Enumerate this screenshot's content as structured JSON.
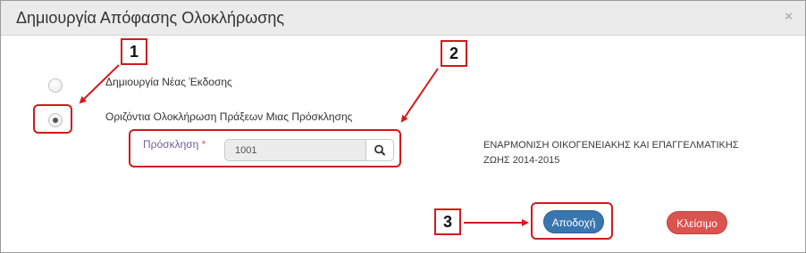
{
  "dialog": {
    "title": "Δημιουργία Απόφασης Ολοκλήρωσης",
    "close_glyph": "×"
  },
  "options": {
    "new_version_label": "Δημιουργία Νέας Έκδοσης",
    "horizontal_label": "Οριζόντια Ολοκλήρωση Πράξεων Μιας Πρόσκλησης",
    "selected": "horizontal"
  },
  "invitation": {
    "label": "Πρόσκληση",
    "required_mark": "*",
    "value": "1001",
    "description_line1": "ΕΝΑΡΜΟΝΙΣΗ ΟΙΚΟΓΕΝΕΙΑΚΗΣ ΚΑΙ ΕΠΑΓΓΕΛΜΑΤΙΚΗΣ",
    "description_line2": "ΖΩΗΣ 2014-2015"
  },
  "buttons": {
    "accept_label": "Αποδοχή",
    "close_label": "Κλείσιμο"
  },
  "annotations": {
    "step1": "1",
    "step2": "2",
    "step3": "3"
  },
  "icons": {
    "search": "search-icon",
    "close": "close-icon"
  },
  "colors": {
    "primary": "#3a76ae",
    "danger": "#d9534f",
    "annotation": "#d11a1a"
  }
}
